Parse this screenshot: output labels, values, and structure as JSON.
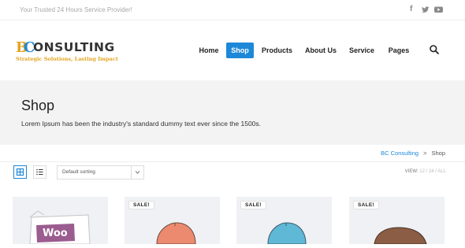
{
  "topbar": {
    "tagline": "Your Trusted 24 Hours Service Provider!",
    "social": [
      {
        "icon": "facebook-icon",
        "glyph": "f"
      },
      {
        "icon": "twitter-icon",
        "glyph": "t"
      },
      {
        "icon": "youtube-icon",
        "glyph": "▶"
      }
    ]
  },
  "logo": {
    "b": "B",
    "c": "C",
    "rest": "ONSULTING",
    "subtitle": "Strategic Solutions, Lasting Impact"
  },
  "nav": {
    "items": [
      {
        "label": "Home",
        "active": false
      },
      {
        "label": "Shop",
        "active": true
      },
      {
        "label": "Products",
        "active": false
      },
      {
        "label": "About Us",
        "active": false
      },
      {
        "label": "Service",
        "active": false
      },
      {
        "label": "Pages",
        "active": false
      }
    ]
  },
  "hero": {
    "title": "Shop",
    "description": "Lorem Ipsum has been the industry's standard dummy text ever since the 1500s."
  },
  "breadcrumb": {
    "home": "BC Consulting",
    "separator": ">",
    "current": "Shop"
  },
  "toolbar": {
    "sort_value": "Default sorting",
    "view_label": "VIEW:",
    "view_options": [
      "12",
      "24",
      "ALL"
    ]
  },
  "products": [
    {
      "sale": "",
      "image": "woo-box"
    },
    {
      "sale": "SALE!",
      "image": "cap-coral"
    },
    {
      "sale": "SALE!",
      "image": "cap-blue"
    },
    {
      "sale": "SALE!",
      "image": "cap-brown"
    }
  ],
  "colors": {
    "accent": "#1e88d8",
    "brand_gold": "#e2a320",
    "hero_bg": "#f3f3f3"
  }
}
